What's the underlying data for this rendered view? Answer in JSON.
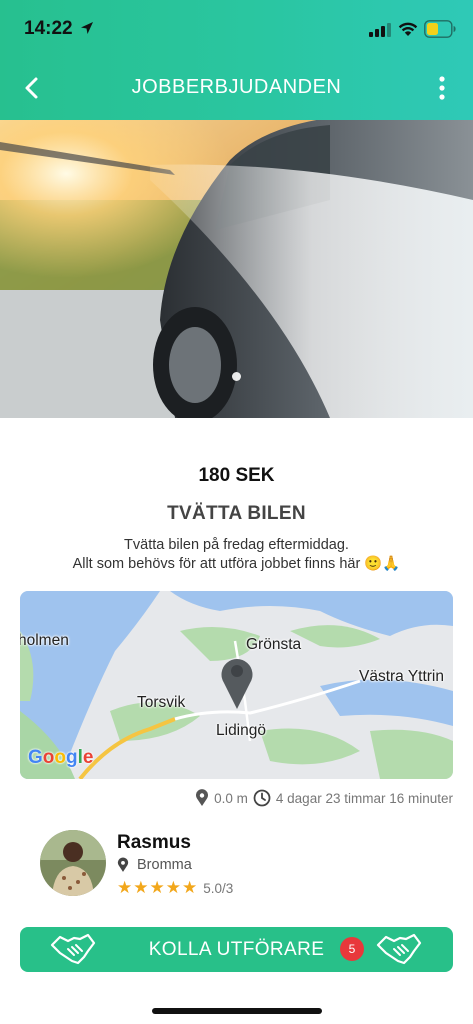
{
  "status_bar": {
    "time": "14:22",
    "icons": [
      "location-arrow-icon",
      "signal-icon",
      "wifi-icon",
      "battery-icon"
    ]
  },
  "nav": {
    "title": "JOBBERBJUDANDEN",
    "back_icon": "chevron-left-icon",
    "more_icon": "more-vertical-icon"
  },
  "hero": {
    "image": "car-wash-photo",
    "carousel_count": 1,
    "carousel_active": 0
  },
  "job": {
    "price": "180 SEK",
    "title": "TVÄTTA BILEN",
    "description_line1": "Tvätta bilen på fredag eftermiddag.",
    "description_line2": "Allt som behövs för att utföra jobbet finns här 🙂🙏"
  },
  "map": {
    "labels": {
      "holmen": "holmen",
      "gronsta": "Grönsta",
      "vastra_yttringe": "Västra Yttrin",
      "torsvik": "Torsvik",
      "lidingo": "Lidingö"
    },
    "google_letters": [
      "G",
      "o",
      "o",
      "g",
      "l",
      "e"
    ]
  },
  "meta": {
    "distance": "0.0 m",
    "time_left": "4 dagar 23 timmar 16 minuter"
  },
  "owner": {
    "name": "Rasmus",
    "location": "Bromma",
    "stars": 5,
    "rating": "5.0/3"
  },
  "cta": {
    "label": "KOLLA UTFÖRARE",
    "badge": "5",
    "icon": "handshake-icon"
  },
  "colors": {
    "brand_green": "#28c089",
    "badge_red": "#e8383b",
    "star_orange": "#f2a71b"
  }
}
